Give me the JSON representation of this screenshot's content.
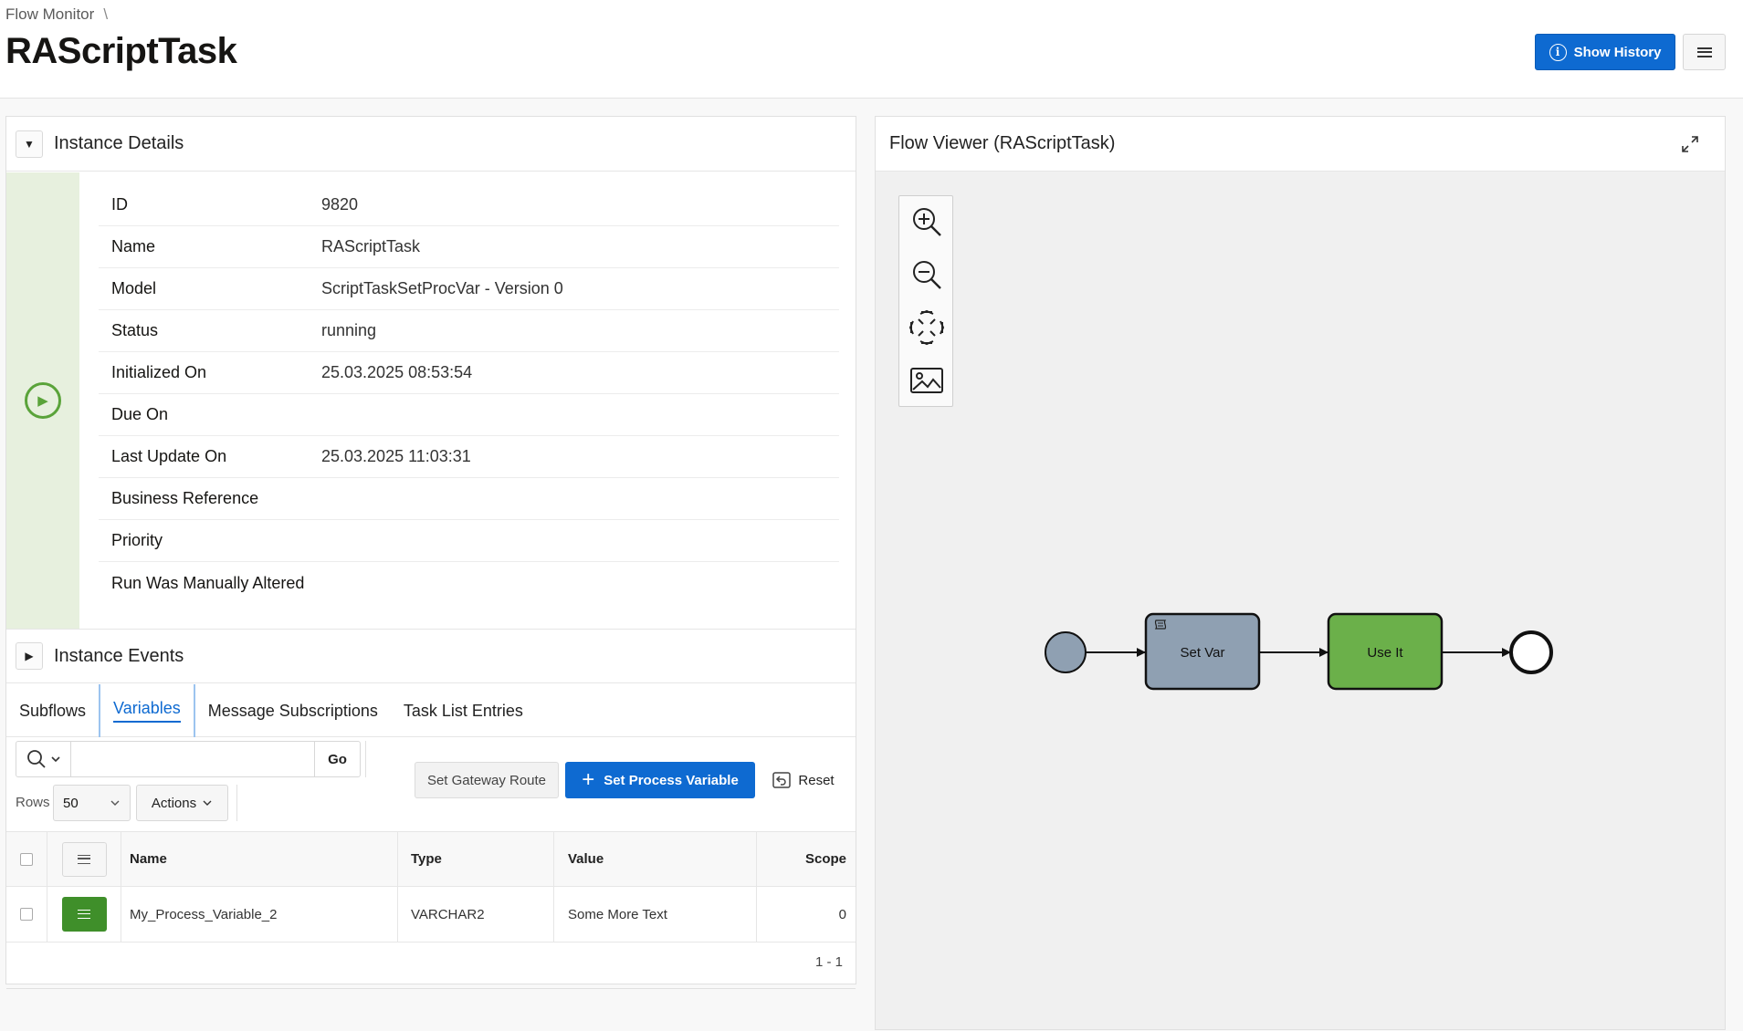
{
  "header": {
    "breadcrumb": "Flow Monitor",
    "breadcrumb_separator": "\\",
    "title": "RAScriptTask",
    "show_history_label": "Show History"
  },
  "instance_details": {
    "region_title": "Instance Details",
    "status_icon": "play-circle-icon",
    "status_color": "#5aa33a",
    "rows": [
      {
        "label": "ID",
        "value": "9820"
      },
      {
        "label": "Name",
        "value": "RAScriptTask"
      },
      {
        "label": "Model",
        "value": "ScriptTaskSetProcVar - Version 0"
      },
      {
        "label": "Status",
        "value": "running"
      },
      {
        "label": "Initialized On",
        "value": "25.03.2025 08:53:54"
      },
      {
        "label": "Due On",
        "value": ""
      },
      {
        "label": "Last Update On",
        "value": "25.03.2025 11:03:31"
      },
      {
        "label": "Business Reference",
        "value": ""
      },
      {
        "label": "Priority",
        "value": ""
      },
      {
        "label": "Run Was Manually Altered",
        "value": ""
      }
    ]
  },
  "instance_events": {
    "region_title": "Instance Events"
  },
  "tabs": [
    {
      "label": "Subflows",
      "active": false
    },
    {
      "label": "Variables",
      "active": true
    },
    {
      "label": "Message Subscriptions",
      "active": false
    },
    {
      "label": "Task List Entries",
      "active": false
    }
  ],
  "toolbar": {
    "search_value": "",
    "go_label": "Go",
    "rows_label": "Rows",
    "rows_value": "50",
    "actions_label": "Actions",
    "set_gateway_route_label": "Set Gateway Route",
    "set_process_variable_label": "Set Process Variable",
    "reset_label": "Reset"
  },
  "grid": {
    "columns": [
      "Name",
      "Type",
      "Value",
      "Scope"
    ],
    "rows": [
      {
        "name": "My_Process_Variable_2",
        "type": "VARCHAR2",
        "value": "Some More Text",
        "scope": "0"
      }
    ],
    "pagination": "1 - 1"
  },
  "flow_viewer": {
    "title": "Flow Viewer (RAScriptTask)",
    "tools": [
      "zoom-in-icon",
      "zoom-out-icon",
      "fit-to-screen-icon",
      "export-image-icon"
    ],
    "nodes": [
      {
        "type": "start-event",
        "label": ""
      },
      {
        "type": "script-task",
        "label": "Set Var",
        "color": "#8fa0b2"
      },
      {
        "type": "task",
        "label": "Use It",
        "color": "#6bb04a"
      },
      {
        "type": "end-event",
        "label": ""
      }
    ]
  },
  "colors": {
    "primary": "#0e6ad1",
    "success": "#3f8f2a"
  }
}
